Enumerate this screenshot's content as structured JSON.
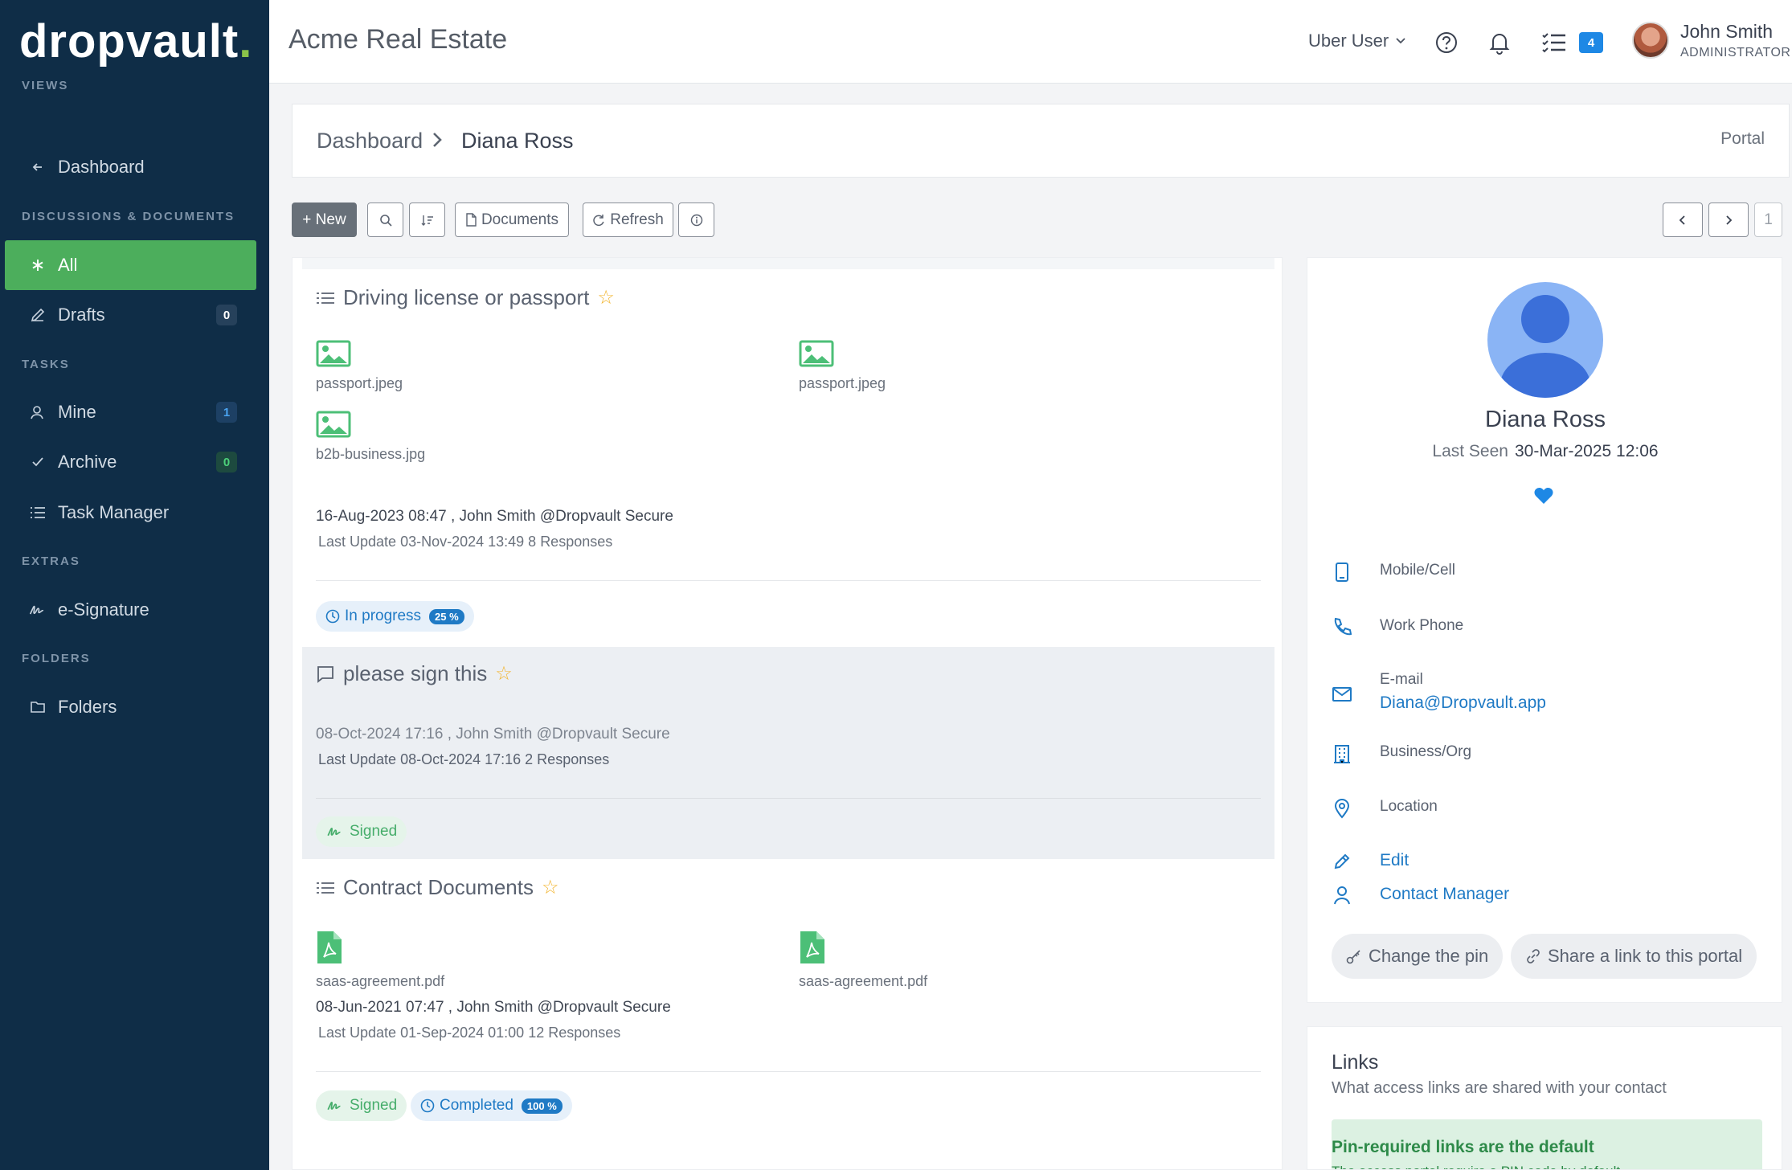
{
  "brand": {
    "logo_text": "dropvault",
    "logo_dot": "."
  },
  "sidebar": {
    "sections": {
      "views": "VIEWS",
      "discussions": "DISCUSSIONS & DOCUMENTS",
      "tasks": "TASKS",
      "extras": "EXTRAS",
      "folders": "FOLDERS"
    },
    "items": [
      {
        "label": "Dashboard",
        "icon": "arrow-left-icon"
      },
      {
        "label": "All",
        "icon": "asterisk-icon",
        "active": true
      },
      {
        "label": "Drafts",
        "icon": "pencil-icon",
        "badge": "0"
      },
      {
        "label": "Mine",
        "icon": "user-icon",
        "badge": "1"
      },
      {
        "label": "Archive",
        "icon": "check-icon",
        "badge": "0"
      },
      {
        "label": "Task Manager",
        "icon": "list-icon"
      },
      {
        "label": "e-Signature",
        "icon": "signature-icon"
      },
      {
        "label": "Folders",
        "icon": "folder-icon"
      }
    ]
  },
  "header": {
    "company": "Acme Real Estate",
    "role_switch": "Uber User",
    "tasks_count": "4",
    "user_name": "John Smith",
    "user_role": "ADMINISTRATOR"
  },
  "breadcrumb": {
    "root": "Dashboard",
    "current": "Diana Ross",
    "portal": "Portal"
  },
  "toolbar": {
    "new_label": "+ New",
    "documents_label": "Documents",
    "refresh_label": "Refresh",
    "page": "1"
  },
  "feed": [
    {
      "title": "Driving license or passport",
      "files": [
        "passport.jpeg",
        "passport.jpeg",
        "b2b-business.jpg"
      ],
      "created": "16-Aug-2023 08:47 , John Smith @Dropvault Secure",
      "updated": "Last Update 03-Nov-2024 13:49   8 Responses",
      "status": "In progress",
      "progress": "25 %"
    },
    {
      "title": "please sign this",
      "created": "08-Oct-2024 17:16 , John Smith @Dropvault Secure",
      "updated": "Last Update 08-Oct-2024 17:16   2 Responses",
      "signed": "Signed"
    },
    {
      "title": "Contract Documents",
      "files": [
        "saas-agreement.pdf",
        "saas-agreement.pdf"
      ],
      "created": "08-Jun-2021 07:47 , John Smith @Dropvault Secure",
      "updated": "Last Update 01-Sep-2024 01:00   12 Responses",
      "signed": "Signed",
      "status": "Completed",
      "progress": "100 %"
    }
  ],
  "contact": {
    "name": "Diana Ross",
    "last_seen_label": "Last Seen",
    "last_seen": "30-Mar-2025 12:06",
    "mobile": "Mobile/Cell",
    "work_phone": "Work Phone",
    "email_label": "E-mail",
    "email": "Diana@Dropvault.app",
    "business": "Business/Org",
    "location": "Location",
    "edit": "Edit",
    "contact_manager": "Contact Manager",
    "change_pin": "Change the pin",
    "share_link": "Share a link to this portal"
  },
  "links": {
    "title": "Links",
    "subtitle": "What access links are shared with your contact",
    "notice_title": "Pin-required links are the default",
    "notice_text": "The access portal require a PIN code by default"
  },
  "colors": {
    "sidebar_bg": "#0f2d47",
    "active_green": "#4cae5c",
    "link_blue": "#1f7ac5",
    "star": "#f2b632"
  }
}
